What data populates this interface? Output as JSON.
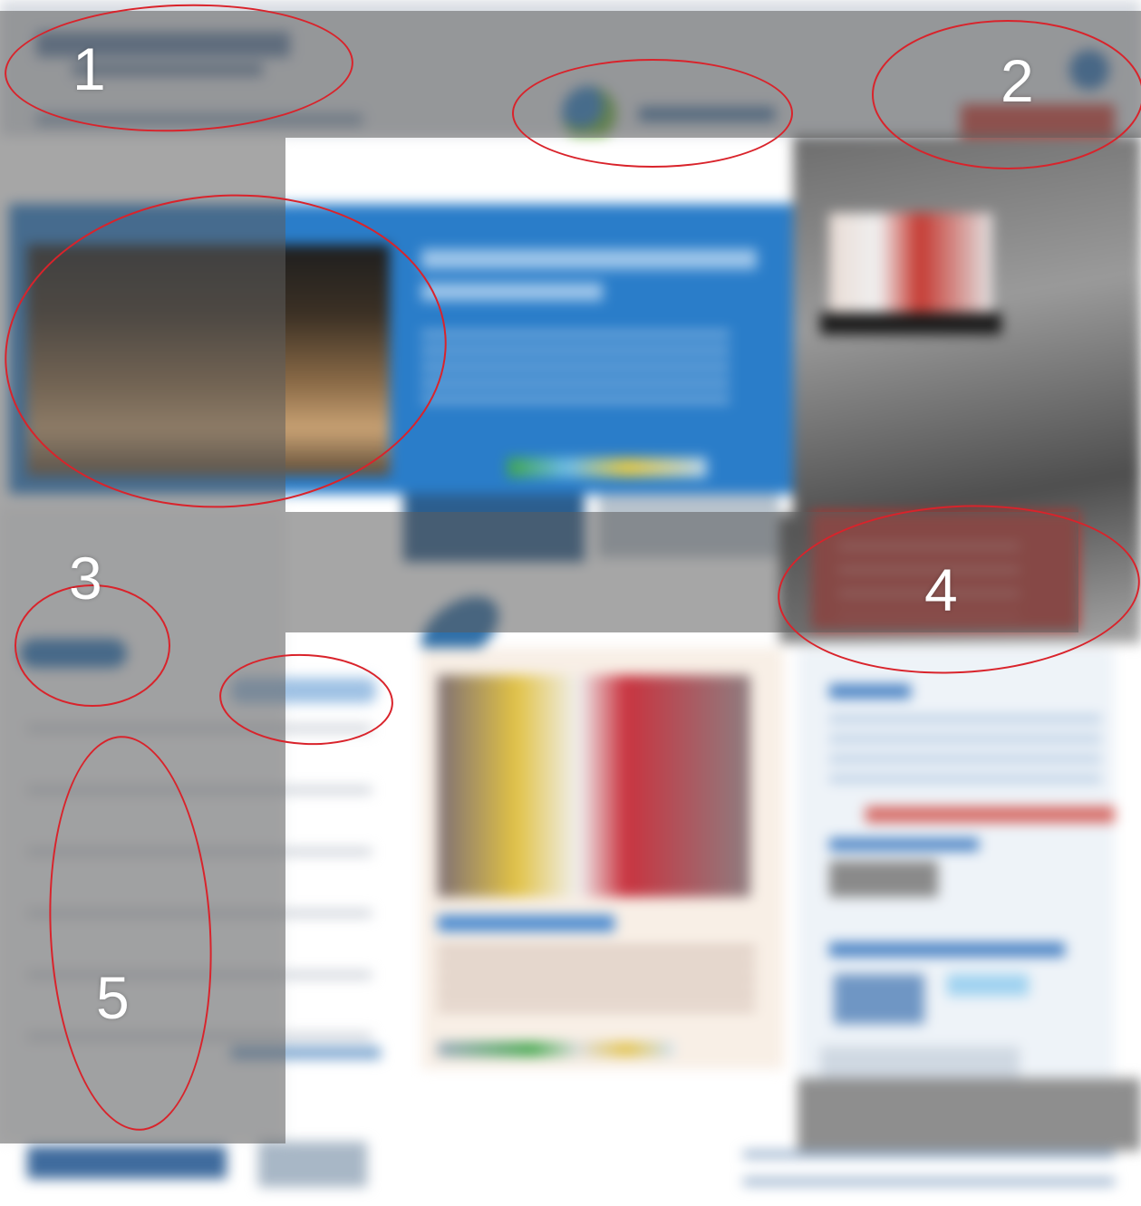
{
  "annotations": {
    "markers": [
      "1",
      "2",
      "3",
      "4",
      "5"
    ]
  },
  "colors": {
    "ellipse_stroke": "#d9232b",
    "overlay_gray": "#5c5c5c",
    "banner_blue": "#2a7dc9",
    "accent_red": "#b8302a"
  }
}
